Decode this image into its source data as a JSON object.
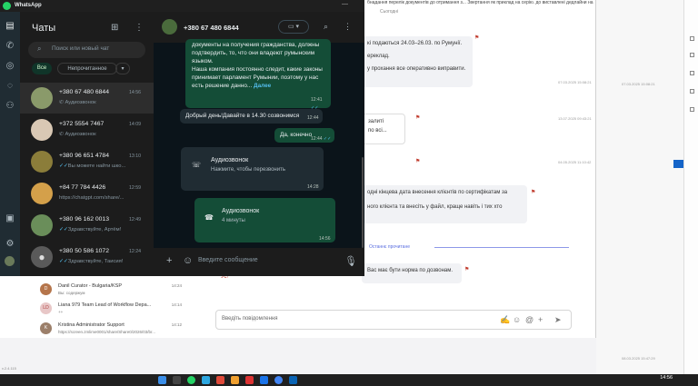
{
  "window_title": "WhatsApp",
  "sidebar_title": "Чаты",
  "search_placeholder": "Поиск или новый чат",
  "filters": {
    "all": "Все",
    "unread": "Непрочитанное"
  },
  "chats": [
    {
      "name": "+380 67 480 6844",
      "preview": "Аудиозвонок",
      "time": "14:56",
      "avatar_color": "#8a9a6a"
    },
    {
      "name": "+372 5554 7467",
      "preview": "Аудиозвонок",
      "time": "14:09",
      "avatar_color": "#d9c8b4"
    },
    {
      "name": "+380 96 651 4784",
      "preview": "Вы можете найти шко...",
      "time": "13:10",
      "avatar_color": "#8b7d3a"
    },
    {
      "name": "+84 77 784 4426",
      "preview": "https://chatgpt.com/share/...",
      "time": "12:59",
      "avatar_color": "#d4a04a"
    },
    {
      "name": "+380 96 162 0013",
      "preview": "Здравствуйте, Артём!",
      "time": "12:49",
      "avatar_color": "#6a8e5a"
    },
    {
      "name": "+380 50 586 1072",
      "preview": "Здравствуйте, Таисия!",
      "time": "12:24",
      "avatar_color": "#5a5a5a"
    }
  ],
  "chat_header": {
    "name": "+380 67 480 6844"
  },
  "messages": {
    "m1_text": "документы на получения гражданства, должны подтвердить, то, что они владеют румынским языком.",
    "m1_text2": "Наша компания постоянно следит, какие законы принимает парламент Румынии, поэтому у нас есть решение данно...",
    "m1_more": "Далее",
    "m1_time": "12:41",
    "m2_text": "Добрый день!Давайте в 14.30 созвонимся",
    "m2_time": "12:44",
    "m3_text": "Да, конечно",
    "m3_time": "12:44",
    "call1_title": "Аудиозвонок",
    "call1_sub": "Нажмите, чтобы перезвонить",
    "call1_time": "14:28",
    "call2_title": "Аудиозвонок",
    "call2_sub": "4 минуты",
    "call2_time": "14:56"
  },
  "composer_placeholder": "Введите сообщение",
  "background": {
    "top_line": "бнадання перелік документів до отримання з... Звертання як приклад на серію. до виставлені дедлайни на яку в МП на 17.... 10:02",
    "date_sep": "Сьогодні",
    "msg1_l1": "кі подаються 24.03–26.03. по Румунії.",
    "msg1_l2": "ереклад.",
    "msg1_l3": "у прохання все оперативно виправити.",
    "msg1_meta": "07.03.2025 15:08:21",
    "msg2_l1": "залиті",
    "msg2_l2": "по всі...",
    "msg2_meta": "13.07.2025 09:43:21",
    "msg3_meta": "04.05.2025 11:10:42",
    "msg4_l1": "одні кінцева дата внесення клієнтів по сертифікатам за",
    "msg4_l2": "ного клієнта та внесіть у файл, краще навіть і тих хто",
    "msg4_meta": "30.03.2025 09:30:21",
    "unread_label": "Останнє прочитане",
    "msg5_l1": "Вас має бути норма по дозвонам.",
    "msg5_l2": "Ус!",
    "reply_placeholder": "Введіть повідомлення",
    "contacts": [
      {
        "initials": "D",
        "name": "Danil Curator - Bulgaria/KSP",
        "sub": "Вы: содержум",
        "time": "14:24"
      },
      {
        "initials": "LD",
        "name": "Liana 979 Team Lead of Workflow Depa...",
        "sub": "++",
        "time": "14:14"
      },
      {
        "initials": "K",
        "name": "Kristina Administrator Support",
        "sub": "https://screen.zmlime0001/share/Share0/2026/03/br...",
        "time": "14:12"
      }
    ],
    "version": "v.2.4.115",
    "right_meta1": "07.03.2025 15:08:21",
    "right_meta2": "08.03.2025 15:47:29",
    "taskbar_time": "14:56"
  }
}
